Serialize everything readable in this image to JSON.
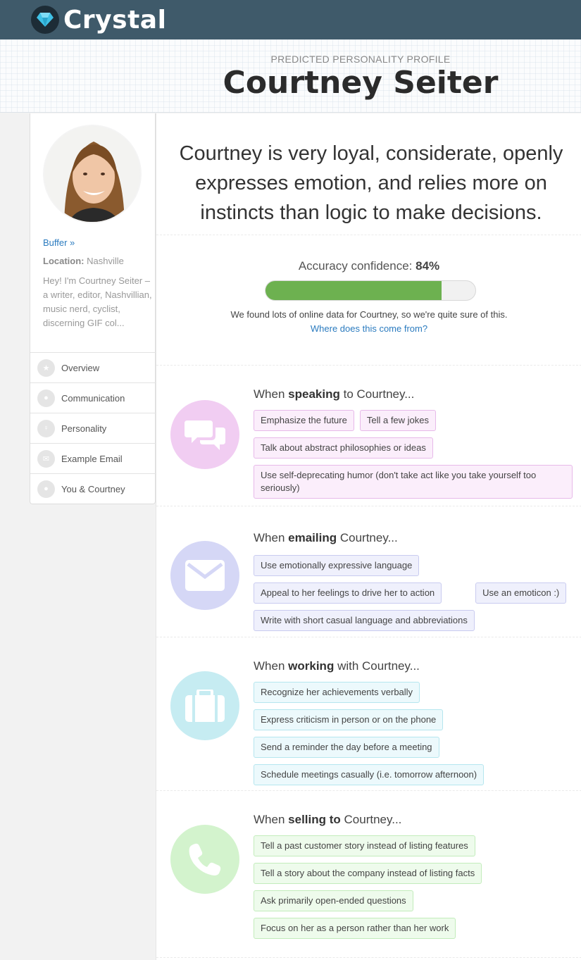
{
  "brand": {
    "name": "Crystal"
  },
  "header": {
    "kicker": "PREDICTED PERSONALITY PROFILE",
    "name": "Courtney Seiter"
  },
  "sidebar": {
    "company_link": "Buffer »",
    "location_label": "Location:",
    "location_value": "Nashville",
    "bio": "Hey! I'm Courtney Seiter – a writer, editor, Nashvillian, music nerd, cyclist, discerning GIF col...",
    "nav": [
      {
        "label": "Overview",
        "icon": "star-icon"
      },
      {
        "label": "Communication",
        "icon": "chat-icon"
      },
      {
        "label": "Personality",
        "icon": "lightbulb-icon"
      },
      {
        "label": "Example Email",
        "icon": "envelope-icon"
      },
      {
        "label": "You & Courtney",
        "icon": "user-icon"
      }
    ]
  },
  "summary": "Courtney is very loyal, considerate, openly expresses emotion, and relies more on instincts than logic to make decisions.",
  "accuracy": {
    "label": "Accuracy confidence:",
    "value_text": "84%",
    "value": 0.84,
    "note": "We found lots of online data for Courtney, so we're quite sure of this.",
    "source_link": "Where does this come from?"
  },
  "sections": {
    "speaking": {
      "prefix": "When",
      "keyword": "speaking",
      "suffix": "to Courtney...",
      "color": "#f1cdf2",
      "icon": "chat-bubbles-icon",
      "tips": [
        "Emphasize the future",
        "Tell a few jokes",
        "Talk about abstract philosophies or ideas",
        "Use self-deprecating humor (don't take act like you take yourself too seriously)"
      ]
    },
    "emailing": {
      "prefix": "When",
      "keyword": "emailing",
      "suffix": "Courtney...",
      "color": "#d5d7f6",
      "icon": "envelope-icon",
      "tips": [
        "Use emotionally expressive language",
        "Appeal to her feelings to drive her to action",
        "Use an emoticon :)",
        "Write with short casual language and abbreviations"
      ]
    },
    "working": {
      "prefix": "When",
      "keyword": "working",
      "suffix": "with Courtney...",
      "color": "#c6ecf2",
      "icon": "briefcase-icon",
      "tips": [
        "Recognize her achievements verbally",
        "Express criticism in person or on the phone",
        "Send a reminder the day before a meeting",
        "Schedule meetings casually (i.e. tomorrow afternoon)"
      ]
    },
    "selling": {
      "prefix": "When",
      "keyword": "selling to",
      "suffix": "Courtney...",
      "color": "#d3f3cd",
      "icon": "phone-icon",
      "tips": [
        "Tell a past customer story instead of listing features",
        "Tell a story about the company instead of listing facts",
        "Ask primarily open-ended questions",
        "Focus on her as a person rather than her work"
      ]
    }
  }
}
